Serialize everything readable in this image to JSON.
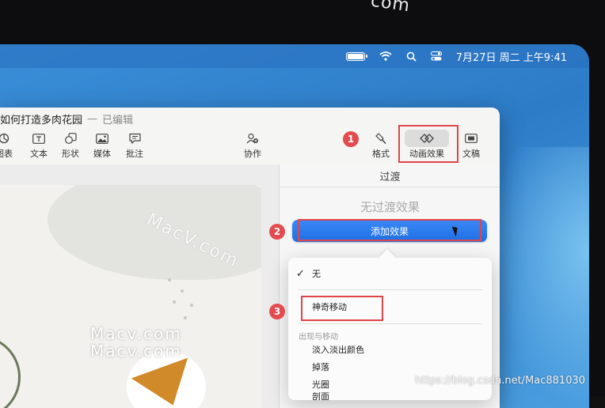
{
  "bezel": {
    "text": "com"
  },
  "menubar": {
    "datetime": "7月27日 周二 上午9:41",
    "icons": [
      "battery-icon",
      "wifi-icon",
      "search-icon",
      "control-center-icon"
    ]
  },
  "window": {
    "title": "如何打造多肉花园",
    "separator": "—",
    "edited": "已编辑"
  },
  "toolbar": {
    "chart_label": "图表",
    "text_label": "文本",
    "shape_label": "形状",
    "media_label": "媒体",
    "comment_label": "批注",
    "collaborate_label": "协作",
    "format_label": "格式",
    "animate_label": "动画效果",
    "document_label": "文稿"
  },
  "panel": {
    "tab": "过渡",
    "no_effect": "无过渡效果",
    "add_effect": "添加效果"
  },
  "menu": {
    "none": "无",
    "check": "✓",
    "magic_move": "神奇移动",
    "section_appear_move": "出现与移动",
    "fade_color": "淡入淡出颜色",
    "drop": "掉落",
    "iris": "光圈",
    "cut_partial": "剖面"
  },
  "annotations": {
    "step1": "1",
    "step2": "2",
    "step3": "3"
  },
  "watermarks": {
    "diag": "MacV.com",
    "line1": "Macv.com",
    "line2": "Macv.com",
    "blog": "https://blog.csdn.net/Mac881030"
  },
  "colors": {
    "accent": "#1f6fe6",
    "callout": "#e0454a",
    "desktop": "#2d7cc8"
  }
}
